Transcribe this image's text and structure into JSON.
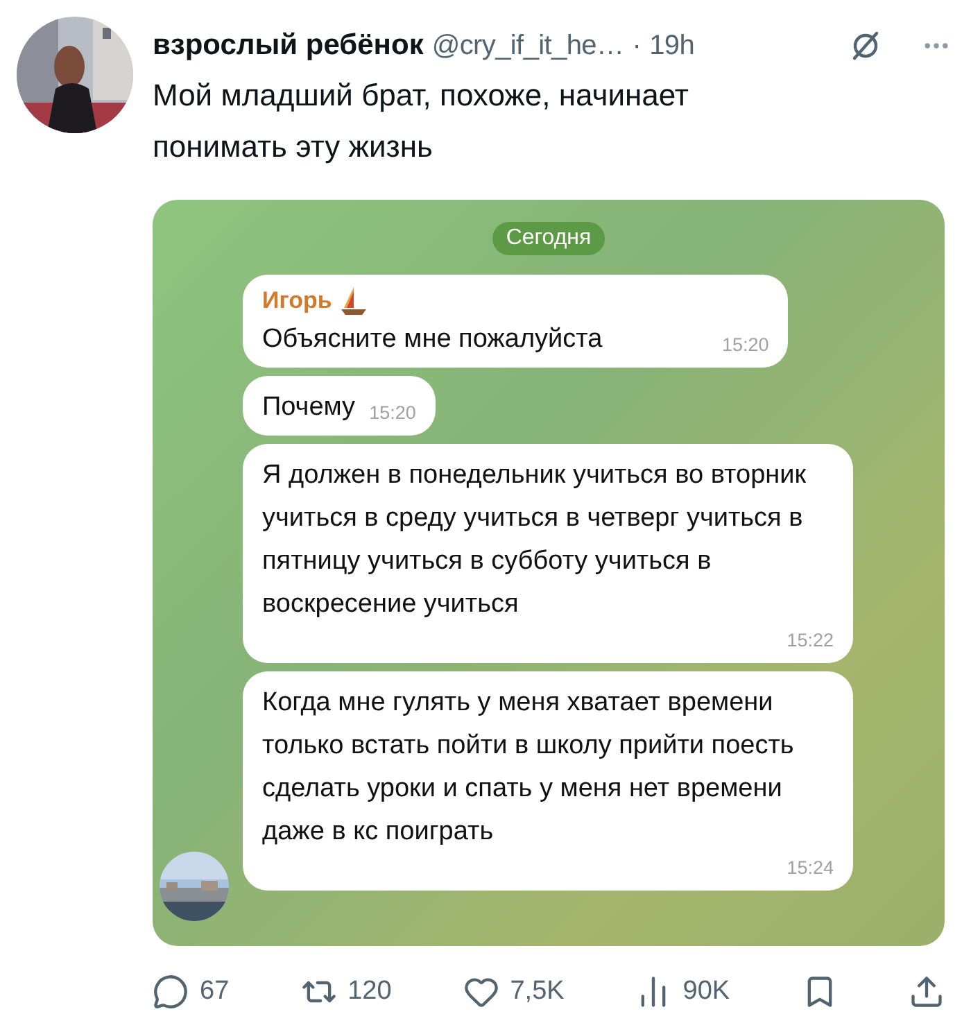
{
  "tweet": {
    "display_name": "взрослый ребёнок",
    "handle": "@cry_if_it_he…",
    "separator": "·",
    "time": "19h",
    "text": "Мой младший брат, похоже, начинает понимать эту жизнь"
  },
  "chat": {
    "date_chip": "Сегодня",
    "messages": [
      {
        "sender": "Игорь",
        "text": "Объясните мне пожалуйста",
        "time": "15:20"
      },
      {
        "text": "Почему",
        "time": "15:20"
      },
      {
        "text": "Я должен в понедельник учиться во вторник учиться в среду учиться в четверг учиться в пятницу учиться в субботу учиться в воскресение учиться",
        "time": "15:22"
      },
      {
        "text": "Когда мне гулять у меня хватает времени только встать пойти в школу прийти поесть сделать уроки и спать у меня нет времени даже в кс поиграть",
        "time": "15:24"
      }
    ]
  },
  "actions": [
    {
      "kind": "reply",
      "count": "67"
    },
    {
      "kind": "repost",
      "count": "120"
    },
    {
      "kind": "like",
      "count": "7,5K"
    },
    {
      "kind": "views",
      "count": "90K"
    },
    {
      "kind": "bookmark"
    },
    {
      "kind": "share"
    }
  ]
}
